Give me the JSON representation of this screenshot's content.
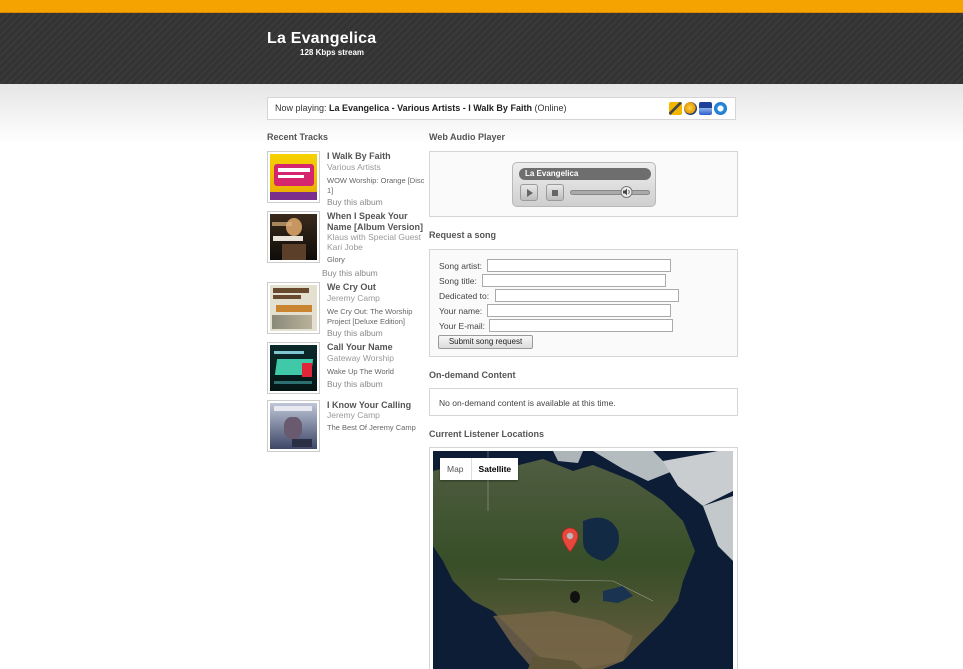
{
  "header": {
    "station_name": "La Evangelica",
    "stream_info": "128 Kbps stream"
  },
  "now_playing": {
    "prefix": "Now playing:",
    "track": "La Evangelica - Various Artists - I Walk By Faith",
    "status": "(Online)",
    "player_icons": [
      "winamp-icon",
      "realplayer-icon",
      "windows-media-icon",
      "quicktime-icon"
    ]
  },
  "recent_tracks": {
    "heading": "Recent Tracks",
    "items": [
      {
        "title": "I Walk By Faith",
        "artist": "Various Artists",
        "album": "WOW Worship: Orange [Disc 1]",
        "buy": "Buy this album"
      },
      {
        "title": "When I Speak Your Name [Album Version]",
        "artist": "Klaus with Special Guest Kari Jobe",
        "album": "Glory",
        "buy": "Buy this album"
      },
      {
        "title": "We Cry Out",
        "artist": "Jeremy Camp",
        "album": "We Cry Out: The Worship Project [Deluxe Edition]",
        "buy": "Buy this album"
      },
      {
        "title": "Call Your Name",
        "artist": "Gateway Worship",
        "album": "Wake Up The World",
        "buy": "Buy this album"
      },
      {
        "title": "I Know Your Calling",
        "artist": "Jeremy Camp",
        "album": "The Best Of Jeremy Camp",
        "buy": ""
      }
    ]
  },
  "web_player": {
    "heading": "Web Audio Player",
    "label": "La Evangelica"
  },
  "request": {
    "heading": "Request a song",
    "fields": {
      "artist": {
        "label": "Song artist:",
        "value": ""
      },
      "title": {
        "label": "Song title:",
        "value": ""
      },
      "dedicated": {
        "label": "Dedicated to:",
        "value": ""
      },
      "name": {
        "label": "Your name:",
        "value": ""
      },
      "email": {
        "label": "Your E-mail:",
        "value": ""
      }
    },
    "submit": "Submit song request"
  },
  "ondemand": {
    "heading": "On-demand Content",
    "message": "No on-demand content is available at this time."
  },
  "locations": {
    "heading": "Current Listener Locations",
    "map_label": "Map",
    "satellite_label": "Satellite"
  },
  "colors": {
    "accent": "#f5a300",
    "header_bg": "#333333",
    "pin": "#e8473c"
  }
}
